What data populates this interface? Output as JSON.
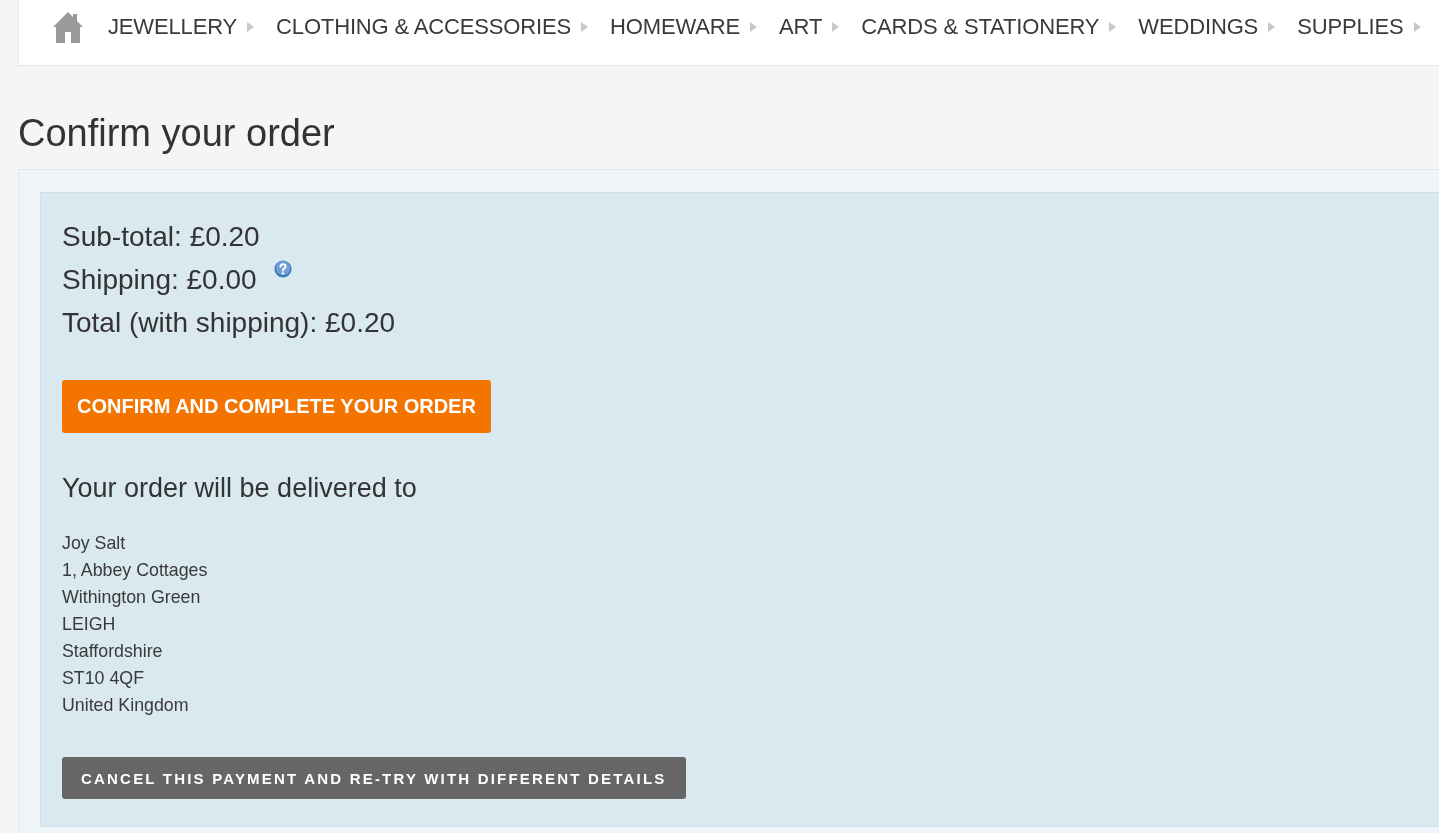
{
  "nav": {
    "items": [
      "JEWELLERY",
      "CLOTHING & ACCESSORIES",
      "HOMEWARE",
      "ART",
      "CARDS & STATIONERY",
      "WEDDINGS",
      "SUPPLIES"
    ]
  },
  "page_title": "Confirm your order",
  "summary": [
    {
      "label": "Sub-total:",
      "value": "£0.20",
      "help": false
    },
    {
      "label": "Shipping:",
      "value": "£0.00",
      "help": true
    },
    {
      "label": "Total (with shipping):",
      "value": "£0.20",
      "help": false
    }
  ],
  "confirm_button": "CONFIRM AND COMPLETE YOUR ORDER",
  "delivery": {
    "heading": "Your order will be delivered to",
    "address_lines": [
      "Joy Salt",
      "1, Abbey Cottages",
      "Withington Green",
      "LEIGH",
      "Staffordshire",
      "ST10 4QF",
      "United Kingdom"
    ]
  },
  "cancel_button": "CANCEL THIS PAYMENT AND RE-TRY WITH DIFFERENT DETAILS"
}
